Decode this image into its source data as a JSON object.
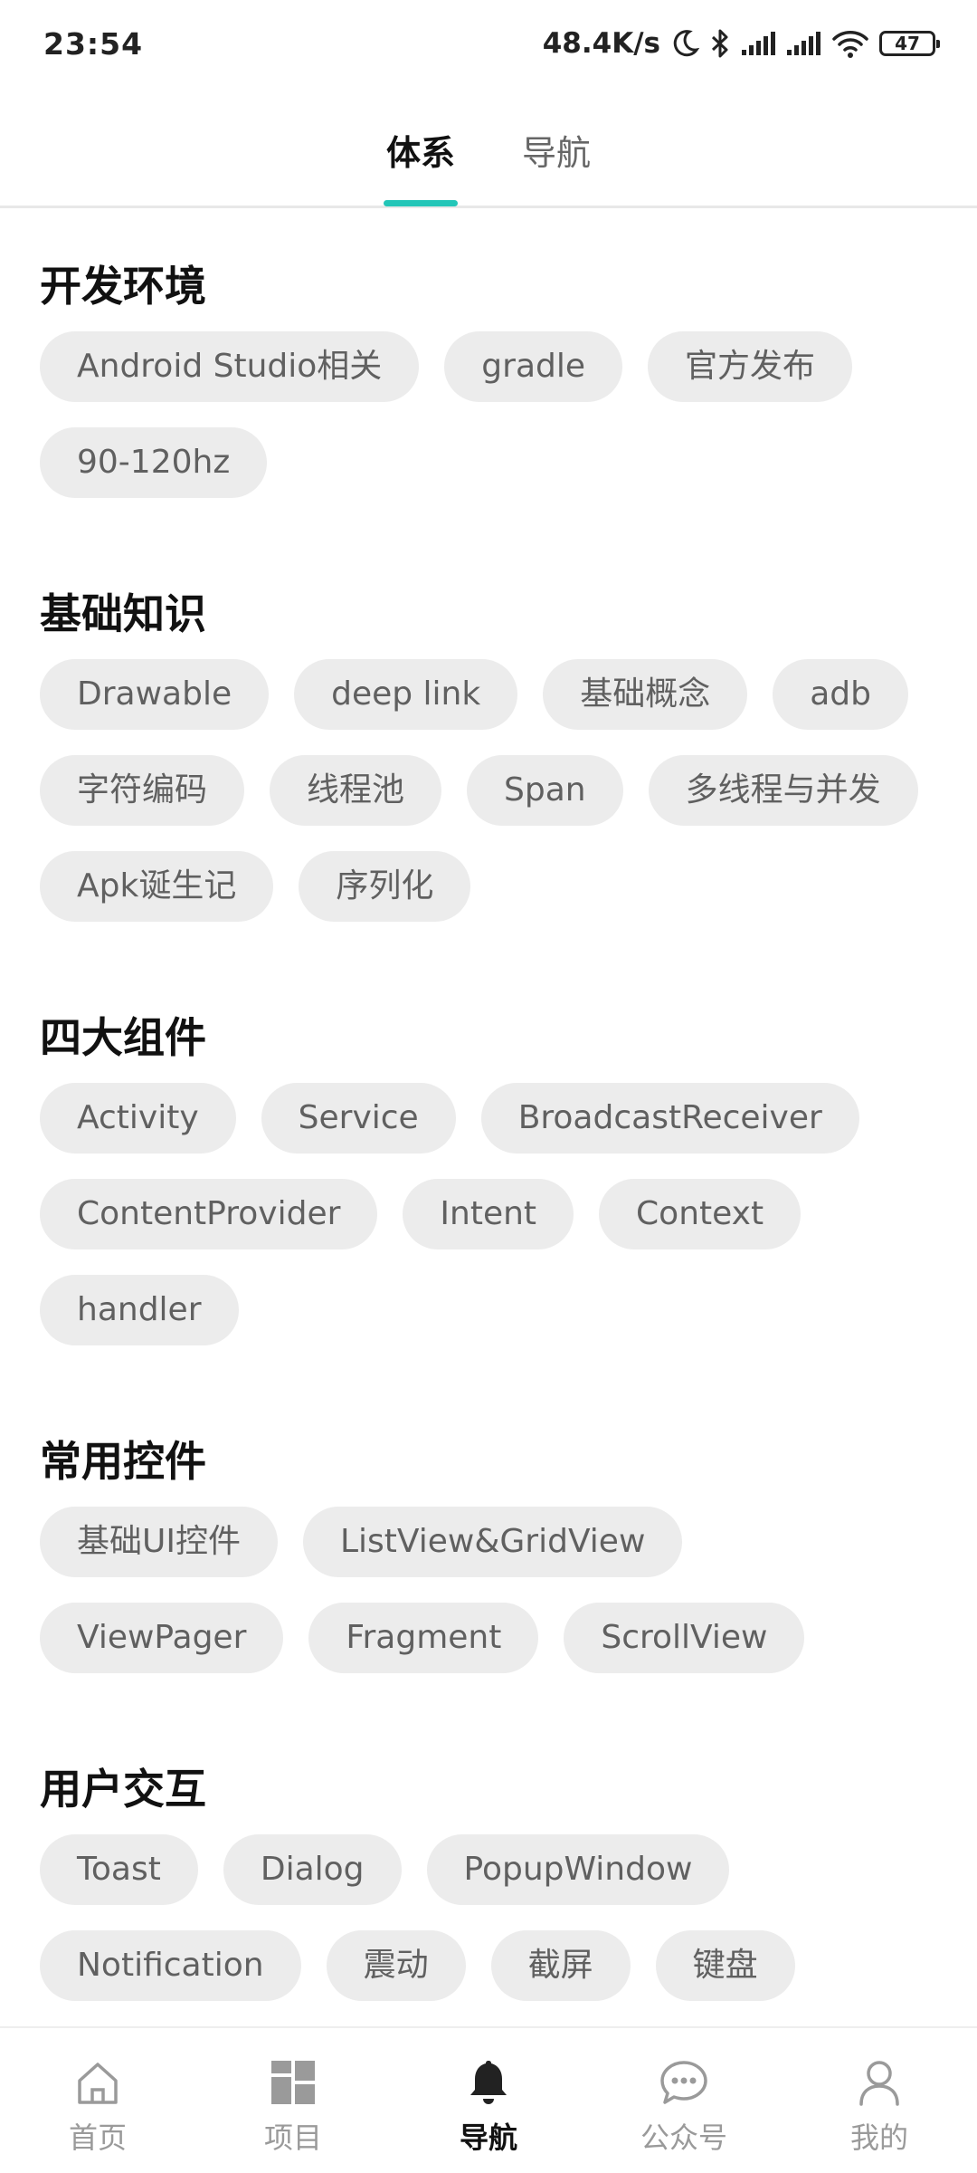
{
  "status_bar": {
    "time": "23:54",
    "network_speed": "48.4K/s",
    "battery": "47",
    "icons": [
      "moon-icon",
      "bluetooth-icon",
      "signal-icon",
      "signal-icon",
      "wifi-icon",
      "battery-icon"
    ]
  },
  "colors": {
    "accent": "#23c6b8",
    "chip_bg": "#ececec",
    "chip_text": "#606060",
    "nav_inactive": "#9a9a9a",
    "nav_active": "#111111"
  },
  "tabs": [
    {
      "label": "体系",
      "active": true
    },
    {
      "label": "导航",
      "active": false
    }
  ],
  "sections": [
    {
      "title": "开发环境",
      "chips": [
        "Android Studio相关",
        "gradle",
        "官方发布",
        "90-120hz"
      ]
    },
    {
      "title": "基础知识",
      "chips": [
        "Drawable",
        "deep link",
        "基础概念",
        "adb",
        "字符编码",
        "线程池",
        "Span",
        "多线程与并发",
        "Apk诞生记",
        "序列化"
      ]
    },
    {
      "title": "四大组件",
      "chips": [
        "Activity",
        "Service",
        "BroadcastReceiver",
        "ContentProvider",
        "Intent",
        "Context",
        "handler"
      ]
    },
    {
      "title": "常用控件",
      "chips": [
        "基础UI控件",
        "ListView&GridView",
        "ViewPager",
        "Fragment",
        "ScrollView"
      ]
    },
    {
      "title": "用户交互",
      "chips": [
        "Toast",
        "Dialog",
        "PopupWindow",
        "Notification",
        "震动",
        "截屏",
        "键盘"
      ]
    }
  ],
  "bottom_nav": [
    {
      "label": "首页",
      "icon": "home-icon",
      "active": false
    },
    {
      "label": "项目",
      "icon": "project-grid-icon",
      "active": false
    },
    {
      "label": "导航",
      "icon": "bell-icon",
      "active": true
    },
    {
      "label": "公众号",
      "icon": "chat-bubble-icon",
      "active": false
    },
    {
      "label": "我的",
      "icon": "user-icon",
      "active": false
    }
  ]
}
